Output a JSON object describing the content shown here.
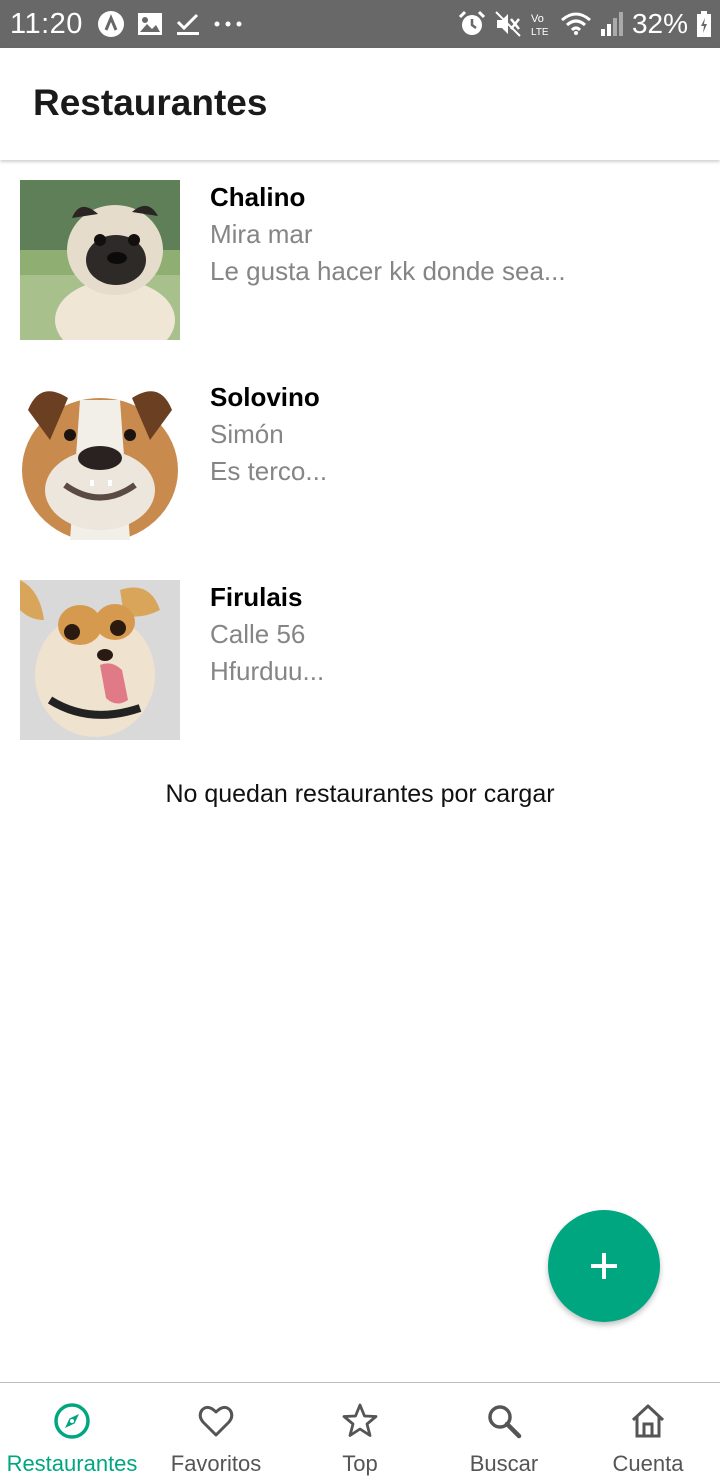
{
  "status_bar": {
    "time": "11:20",
    "battery_percent": "32%",
    "left_icons": [
      "app-notification-icon",
      "image-icon",
      "checkmark-icon",
      "more-dots-icon"
    ],
    "right_icons": [
      "alarm-icon",
      "mute-icon",
      "volte-icon",
      "wifi-icon",
      "signal-icon",
      "battery-charging-icon"
    ],
    "volte_text": "Vo LTE"
  },
  "header": {
    "title": "Restaurantes"
  },
  "restaurants": [
    {
      "name": "Chalino",
      "address": "Mira mar",
      "description": "Le gusta hacer kk donde sea..."
    },
    {
      "name": "Solovino",
      "address": "Simón",
      "description": "Es terco..."
    },
    {
      "name": "Firulais",
      "address": "Calle 56",
      "description": "Hfurduu..."
    }
  ],
  "list_end_message": "No quedan restaurantes por cargar",
  "fab": {
    "icon": "plus-icon",
    "color": "#00a680"
  },
  "bottom_nav": {
    "active_color": "#00a680",
    "items": [
      {
        "label": "Restaurantes",
        "icon": "compass-icon",
        "active": true
      },
      {
        "label": "Favoritos",
        "icon": "heart-icon",
        "active": false
      },
      {
        "label": "Top",
        "icon": "star-icon",
        "active": false
      },
      {
        "label": "Buscar",
        "icon": "search-icon",
        "active": false
      },
      {
        "label": "Cuenta",
        "icon": "home-icon",
        "active": false
      }
    ]
  }
}
